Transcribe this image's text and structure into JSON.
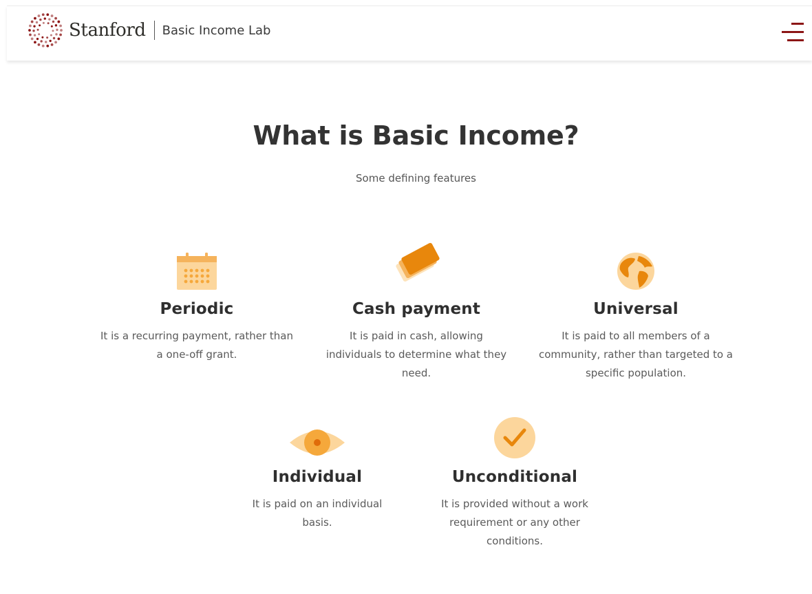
{
  "header": {
    "brand": "Stanford",
    "lab_name": "Basic Income Lab",
    "logo_icon": "stanford-seal-icon",
    "menu_icon": "hamburger-menu-icon"
  },
  "main": {
    "title": "What is Basic Income?",
    "subtitle": "Some defining features",
    "features": [
      {
        "label": "Periodic",
        "icon": "calendar-icon",
        "description": "It is a recurring payment, rather than a one-off grant."
      },
      {
        "label": "Cash payment",
        "icon": "cash-bills-icon",
        "description": "It is paid in cash, allowing individuals to determine what they need."
      },
      {
        "label": "Universal",
        "icon": "globe-icon",
        "description": "It is paid to all members of a community, rather than targeted to a specific population."
      },
      {
        "label": "Individual",
        "icon": "eye-icon",
        "description": "It is paid on an individual basis."
      },
      {
        "label": "Unconditional",
        "icon": "checkmark-circle-icon",
        "description": "It is provided without a work requirement or any other conditions."
      }
    ]
  },
  "colors": {
    "accent": "#8c1515",
    "icon_light": "#fcd69c",
    "icon_mid": "#f5b35c",
    "icon_dark": "#e8870c"
  }
}
